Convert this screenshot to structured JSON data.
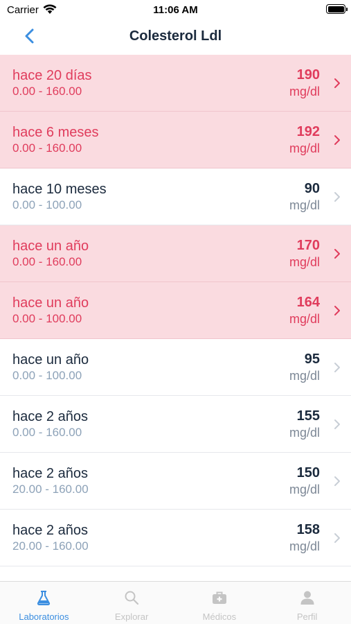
{
  "status": {
    "carrier": "Carrier",
    "time": "11:06 AM"
  },
  "nav": {
    "title": "Colesterol Ldl"
  },
  "colors": {
    "accent": "#3b8ee0",
    "alert_bg": "#fadbe0",
    "alert_text": "#e03c5c",
    "inactive": "#c4c4c4"
  },
  "results": [
    {
      "when": "hace 20 días",
      "range": "0.00 - 160.00",
      "value": "190",
      "unit": "mg/dl",
      "alert": true
    },
    {
      "when": "hace 6 meses",
      "range": "0.00 - 160.00",
      "value": "192",
      "unit": "mg/dl",
      "alert": true
    },
    {
      "when": "hace 10 meses",
      "range": "0.00 - 100.00",
      "value": "90",
      "unit": "mg/dl",
      "alert": false
    },
    {
      "when": "hace un año",
      "range": "0.00 - 160.00",
      "value": "170",
      "unit": "mg/dl",
      "alert": true
    },
    {
      "when": "hace un año",
      "range": "0.00 - 100.00",
      "value": "164",
      "unit": "mg/dl",
      "alert": true
    },
    {
      "when": "hace un año",
      "range": "0.00 - 100.00",
      "value": "95",
      "unit": "mg/dl",
      "alert": false
    },
    {
      "when": "hace 2 años",
      "range": "0.00 - 160.00",
      "value": "155",
      "unit": "mg/dl",
      "alert": false
    },
    {
      "when": "hace 2 años",
      "range": "20.00 - 160.00",
      "value": "150",
      "unit": "mg/dl",
      "alert": false
    },
    {
      "when": "hace 2 años",
      "range": "20.00 - 160.00",
      "value": "158",
      "unit": "mg/dl",
      "alert": false
    }
  ],
  "tabs": [
    {
      "label": "Laboratorios",
      "icon": "flask-icon",
      "active": true
    },
    {
      "label": "Explorar",
      "icon": "search-icon",
      "active": false
    },
    {
      "label": "Médicos",
      "icon": "medical-kit-icon",
      "active": false
    },
    {
      "label": "Perfil",
      "icon": "person-icon",
      "active": false
    }
  ]
}
